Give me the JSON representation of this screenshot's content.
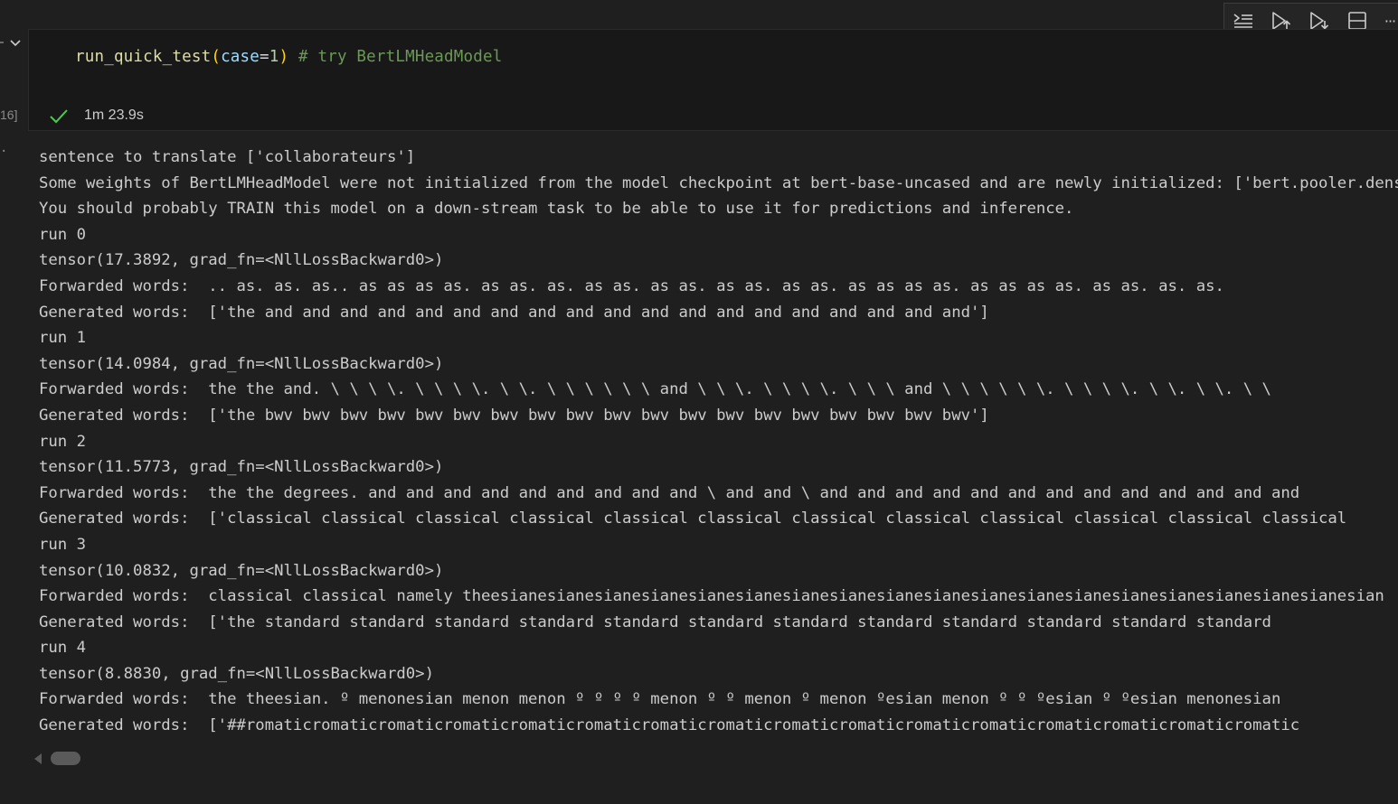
{
  "cell": {
    "code": {
      "fn": "run_quick_test",
      "open_paren": "(",
      "param": "case",
      "eq": "=",
      "num": "1",
      "close_paren": ")",
      "comment": " # try BertLMHeadModel"
    },
    "execution_count": "16]",
    "exec_time": "1m 23.9s"
  },
  "toolbar": {
    "icons": [
      "run-by-line-icon",
      "run-above-icon",
      "run-below-icon",
      "split-cell-icon",
      "more-icon"
    ],
    "more_label": "···"
  },
  "output": {
    "dots": "·",
    "lines": [
      "sentence to translate ['collaborateurs']",
      "Some weights of BertLMHeadModel were not initialized from the model checkpoint at bert-base-uncased and are newly initialized: ['bert.pooler.dense.weight', 'bert.pooler.dense.bias']",
      "You should probably TRAIN this model on a down-stream task to be able to use it for predictions and inference.",
      "run 0",
      "tensor(17.3892, grad_fn=<NllLossBackward0>)",
      "Forwarded words:  .. as. as. as.. as as as as. as as. as. as as. as as. as as. as as. as as as as. as as as as. as as. as. as.",
      "Generated words:  ['the and and and and and and and and and and and and and and and and and and and']",
      "run 1",
      "tensor(14.0984, grad_fn=<NllLossBackward0>)",
      "Forwarded words:  the the and. \\ \\ \\ \\. \\ \\ \\ \\. \\ \\. \\ \\ \\ \\ \\ \\ and \\ \\ \\. \\ \\ \\ \\. \\ \\ \\ and \\ \\ \\ \\ \\ \\. \\ \\ \\ \\. \\ \\. \\ \\. \\ \\",
      "Generated words:  ['the bwv bwv bwv bwv bwv bwv bwv bwv bwv bwv bwv bwv bwv bwv bwv bwv bwv bwv bwv']",
      "run 2",
      "tensor(11.5773, grad_fn=<NllLossBackward0>)",
      "Forwarded words:  the the degrees. and and and and and and and and and \\ and and \\ and and and and and and and and and and and and and",
      "Generated words:  ['classical classical classical classical classical classical classical classical classical classical classical classical",
      "run 3",
      "tensor(10.0832, grad_fn=<NllLossBackward0>)",
      "Forwarded words:  classical classical namely theesianesianesianesianesianesianesianesianesianesianesianesianesianesianesianesianesianesianesian",
      "Generated words:  ['the standard standard standard standard standard standard standard standard standard standard standard standard",
      "run 4",
      "tensor(8.8830, grad_fn=<NllLossBackward0>)",
      "Forwarded words:  the theesian. º menonesian menon menon º º º º menon º º menon º menon ºesian menon º º ºesian º ºesian menonesian",
      "Generated words:  ['##romaticromaticromaticromaticromaticromaticromaticromaticromaticromaticromaticromaticromaticromaticromaticromatic"
    ]
  }
}
